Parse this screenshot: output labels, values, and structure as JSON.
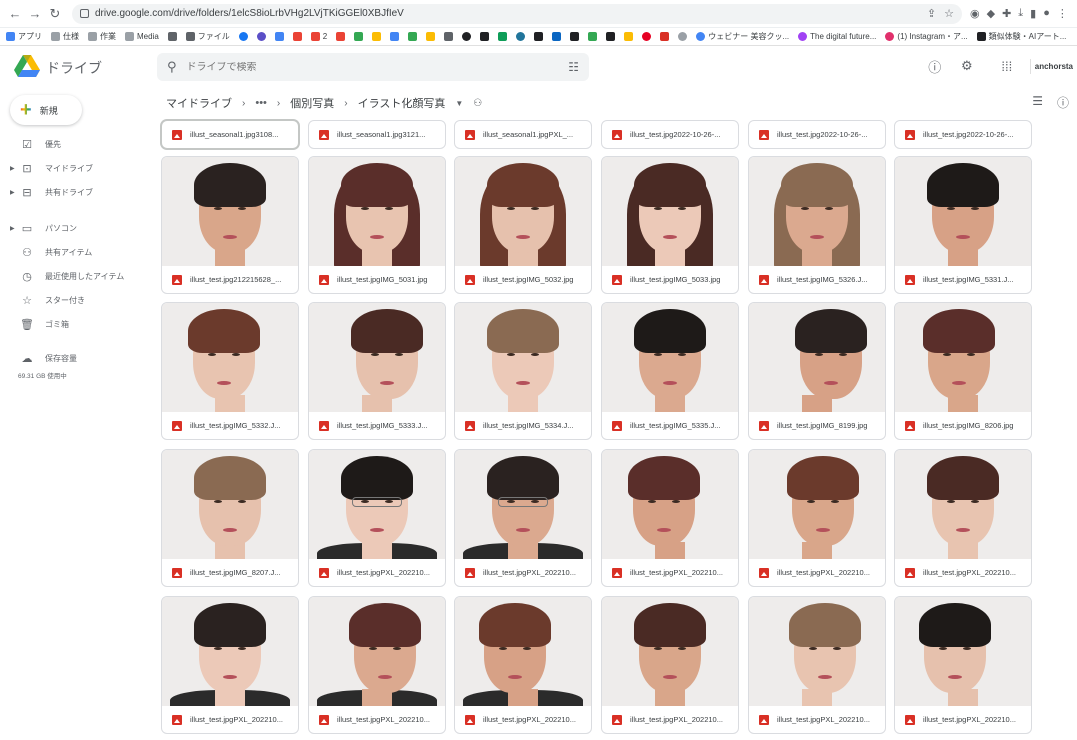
{
  "browser": {
    "url": "drive.google.com/drive/folders/1elcS8ioLrbVHg2LVjTKiGGEl0XBJfIeV",
    "bookmarks": [
      "アプリ",
      "仕様",
      "作業",
      "Media",
      "ファイル",
      "2",
      "ウェビナー 美容クッ...",
      "The digital future...",
      "(1) Instagram・ア...",
      "類似体験・AIアート..."
    ]
  },
  "header": {
    "app_name": "ドライブ",
    "search_placeholder": "ドライブで検索",
    "account_label": "anchorsta"
  },
  "sidebar": {
    "new_label": "新規",
    "items": [
      {
        "label": "優先",
        "icon": "check-circle-icon",
        "expandable": false
      },
      {
        "label": "マイドライブ",
        "icon": "my-drive-icon",
        "expandable": true
      },
      {
        "label": "共有ドライブ",
        "icon": "shared-drive-icon",
        "expandable": true
      },
      {
        "label": "パソコン",
        "icon": "computer-icon",
        "expandable": true
      },
      {
        "label": "共有アイテム",
        "icon": "people-icon",
        "expandable": false
      },
      {
        "label": "最近使用したアイテム",
        "icon": "clock-icon",
        "expandable": false
      },
      {
        "label": "スター付き",
        "icon": "star-icon",
        "expandable": false
      },
      {
        "label": "ゴミ箱",
        "icon": "trash-icon",
        "expandable": false
      },
      {
        "label": "保存容量",
        "icon": "cloud-icon",
        "expandable": false
      }
    ],
    "storage_text": "69.31 GB 使用中"
  },
  "breadcrumb": {
    "root": "マイドライブ",
    "ellipsis": "•••",
    "middle": "個別写真",
    "current": "イラスト化顔写真"
  },
  "files": {
    "top_row": [
      "illust_seasonal1.jpg3108...",
      "illust_seasonal1.jpg3121...",
      "illust_seasonal1.jpgPXL_...",
      "illust_test.jpg2022-10-26-...",
      "illust_test.jpg2022-10-26-...",
      "illust_test.jpg2022-10-26-..."
    ],
    "rows": [
      [
        "illust_test.jpg212215628_...",
        "illust_test.jpgIMG_5031.jpg",
        "illust_test.jpgIMG_5032.jpg",
        "illust_test.jpgIMG_5033.jpg",
        "illust_test.jpgIMG_5326.J...",
        "illust_test.jpgIMG_5331.J..."
      ],
      [
        "illust_test.jpgIMG_5332.J...",
        "illust_test.jpgIMG_5333.J...",
        "illust_test.jpgIMG_5334.J...",
        "illust_test.jpgIMG_5335.J...",
        "illust_test.jpgIMG_8199.jpg",
        "illust_test.jpgIMG_8206.jpg"
      ],
      [
        "illust_test.jpgIMG_8207.J...",
        "illust_test.jpgPXL_202210...",
        "illust_test.jpgPXL_202210...",
        "illust_test.jpgPXL_202210...",
        "illust_test.jpgPXL_202210...",
        "illust_test.jpgPXL_202210..."
      ],
      [
        "illust_test.jpgPXL_202210...",
        "illust_test.jpgPXL_202210...",
        "illust_test.jpgPXL_202210...",
        "illust_test.jpgPXL_202210...",
        "illust_test.jpgPXL_202210...",
        "illust_test.jpgPXL_202210..."
      ]
    ]
  }
}
